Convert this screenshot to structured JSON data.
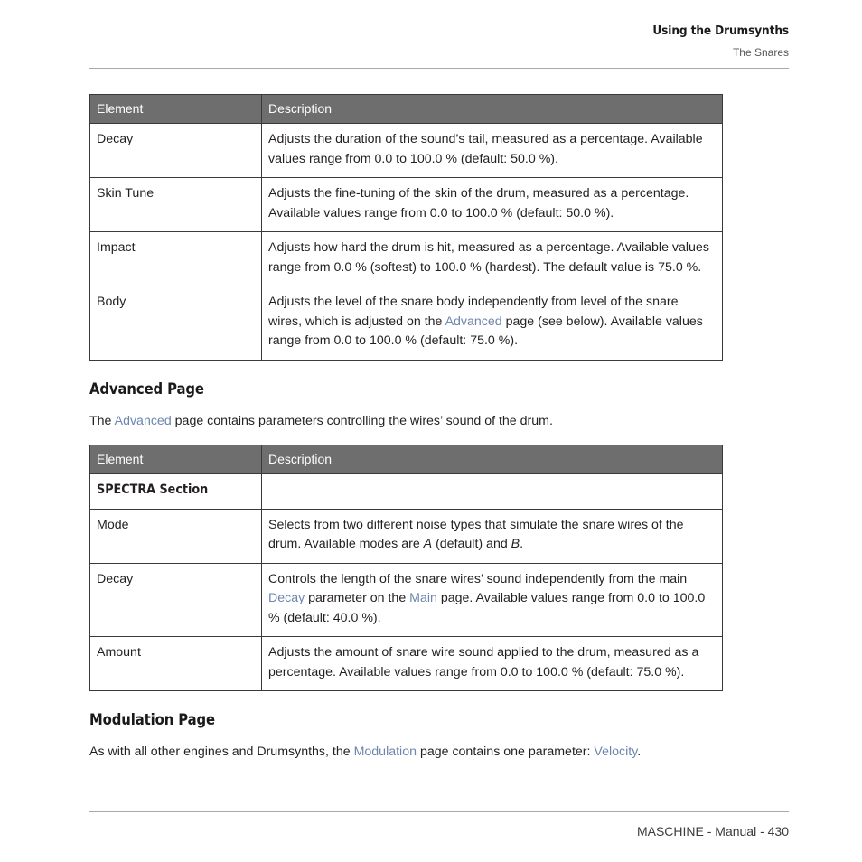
{
  "header": {
    "title": "Using the Drumsynths",
    "subtitle": "The Snares"
  },
  "tables": {
    "columns": [
      "Element",
      "Description"
    ],
    "main": {
      "rows": [
        {
          "element": "Decay",
          "description_1": "Adjusts the duration of the sound’s tail, measured as a percentage. Available values range from 0.0 to 100.0 % (default: 50.0 %)."
        },
        {
          "element": "Skin Tune",
          "description_1": "Adjusts the fine-tuning of the skin of the drum, measured as a percentage. Available values range from 0.0 to 100.0 % (default: 50.0 %)."
        },
        {
          "element": "Impact",
          "description_1": "Adjusts how hard the drum is hit, measured as a percentage. Available values range from 0.0 % (softest) to 100.0 % (hardest). The default value is 75.0 %."
        },
        {
          "element": "Body",
          "description_1": "Adjusts the level of the snare body independently from level of the snare wires, which is adjusted on the ",
          "link_1": "Advanced",
          "description_2": " page (see below). Available values range from 0.0 to 100.0 % (default: 75.0 %)."
        }
      ]
    },
    "advanced": {
      "rows": [
        {
          "element": "SPECTRA Section",
          "description_1": ""
        },
        {
          "element": "Mode",
          "description_1": "Selects from two different noise types that simulate the snare wires of the drum. Available modes are ",
          "italic_1": "A",
          "description_2": " (default) and ",
          "italic_2": "B",
          "description_3": "."
        },
        {
          "element": "Decay",
          "description_1": "Controls the length of the snare wires’ sound independently from the main ",
          "link_1": "Decay",
          "description_2": " parameter on the ",
          "link_2": "Main",
          "description_3": " page. Available values range from 0.0 to 100.0 % (default: 40.0 %)."
        },
        {
          "element": "Amount",
          "description_1": "Adjusts the amount of snare wire sound applied to the drum, measured as a percentage. Available values range from 0.0 to 100.0 % (default: 75.0 %)."
        }
      ]
    }
  },
  "sections": {
    "advanced_page": {
      "heading": "Advanced Page",
      "paragraph_1": "The ",
      "link_1": "Advanced",
      "paragraph_2": " page contains parameters controlling the wires’ sound of the drum."
    },
    "modulation_page": {
      "heading": "Modulation Page",
      "paragraph_1": "As with all other engines and Drumsynths, the ",
      "link_1": "Modulation",
      "paragraph_2": " page contains one parameter: ",
      "link_2": "Velocity",
      "paragraph_3": "."
    }
  },
  "footer": {
    "text": "MASCHINE - Manual - 430"
  },
  "colors": {
    "link": "#6b86ad",
    "table_header_bg": "#6e6e6e",
    "table_header_text": "#ffffff",
    "body_text": "#231f20",
    "rule": "#a8a9ad"
  }
}
